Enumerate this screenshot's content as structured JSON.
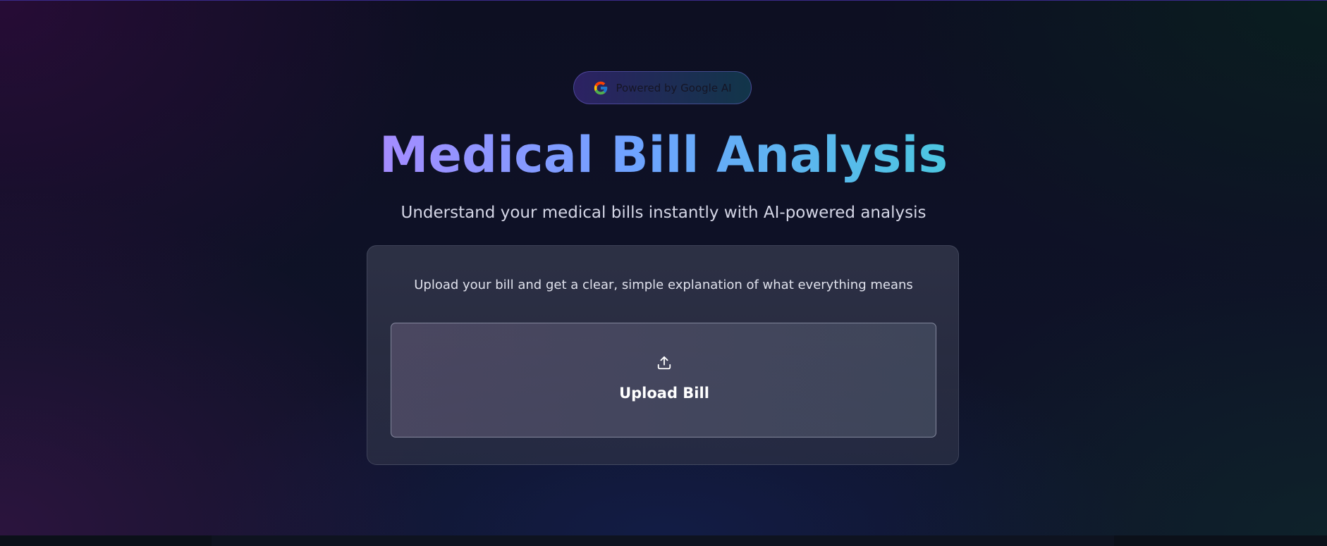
{
  "badge": {
    "icon": "google-g-icon",
    "label": "Powered by Google AI"
  },
  "hero": {
    "title": "Medical Bill Analysis",
    "subtitle": "Understand your medical bills instantly with AI-powered analysis"
  },
  "card": {
    "description": "Upload your bill and get a clear, simple explanation of what everything means",
    "upload": {
      "icon": "upload-icon",
      "label": "Upload Bill"
    }
  },
  "colors": {
    "title_gradient_start": "#a58cff",
    "title_gradient_mid": "#6ea3ff",
    "title_gradient_end": "#4cc6e0",
    "background": "#0c0f1e",
    "card": "#3a3e52"
  }
}
